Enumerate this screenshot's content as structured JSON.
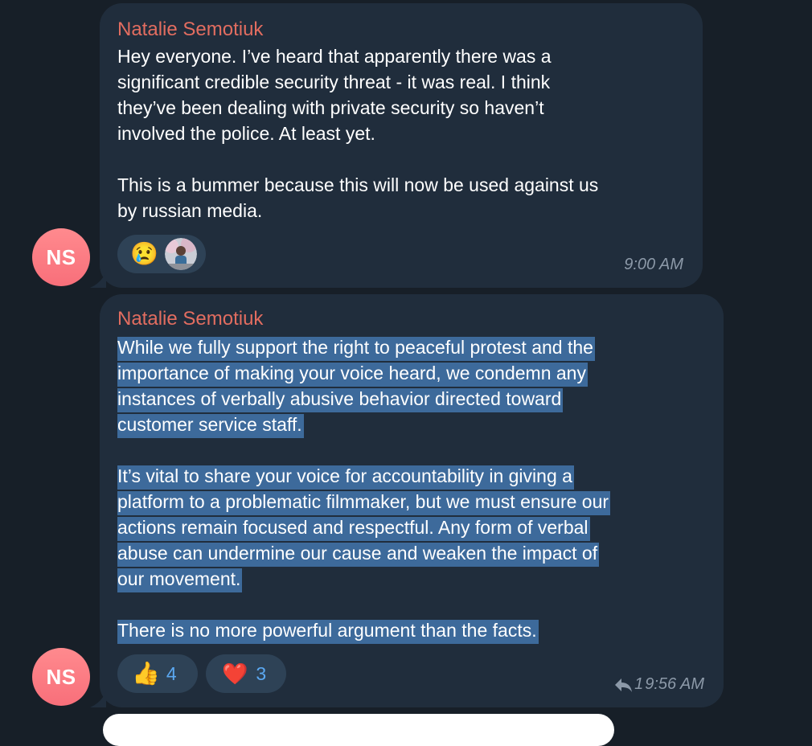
{
  "messages": [
    {
      "sender": "Natalie Semotiuk",
      "avatar_initials": "NS",
      "lines": [
        "Hey everyone. I’ve heard that apparently there was a",
        "significant credible security threat - it was real. I think",
        "they’ve been dealing with private security so haven’t",
        "involved the police. At least yet.",
        "",
        "This is a bummer because this will now be used against us",
        "by russian media."
      ],
      "reactions": [
        {
          "emoji": "😢",
          "icon": "crying-face-icon"
        }
      ],
      "time": "9:00 AM"
    },
    {
      "sender": "Natalie Semotiuk",
      "avatar_initials": "NS",
      "lines": [
        "While we fully support the right to peaceful protest and the",
        "importance of making your voice heard, we condemn any",
        "instances of verbally abusive behavior directed toward",
        "customer service staff.",
        "",
        "It’s vital to share your voice for accountability in giving a",
        "platform to a problematic filmmaker, but we must ensure our",
        "actions remain focused and respectful. Any form of verbal",
        "abuse can undermine our cause and weaken the impact of",
        "our movement.",
        "",
        "There is no more powerful argument than the facts."
      ],
      "reactions": [
        {
          "emoji": "👍",
          "icon": "thumbs-up-icon",
          "count": "4"
        },
        {
          "emoji": "❤️",
          "icon": "heart-icon",
          "count": "3"
        }
      ],
      "reply_count": "1",
      "time": "9:56 AM"
    }
  ],
  "colors": {
    "background": "#171f28",
    "bubble": "#202d3c",
    "sender": "#e26d60",
    "selection": "#3d6a9b",
    "reaction_bg": "#2e4256",
    "reaction_count": "#5ba8f1",
    "avatar": "#f86f7a"
  }
}
